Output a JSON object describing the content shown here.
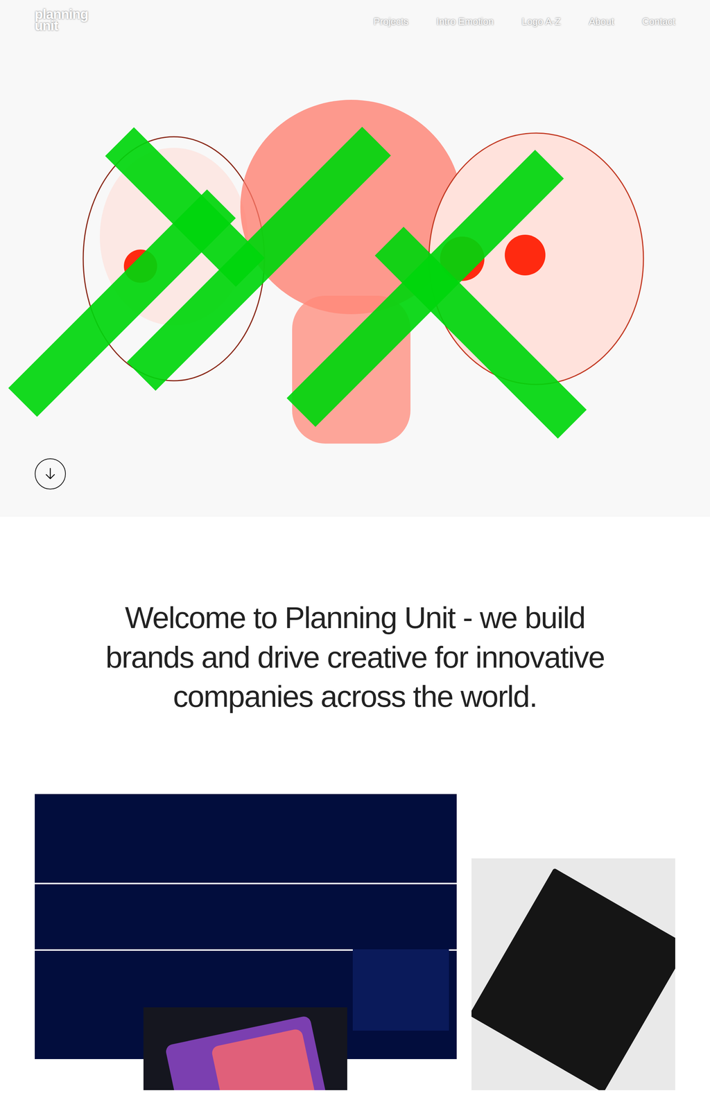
{
  "header": {
    "logo": [
      "planning",
      "unit"
    ],
    "nav": [
      {
        "label": "Projects",
        "selected": false
      },
      {
        "label": "Intro Emotion",
        "selected": false
      },
      {
        "label": "Logo A-Z",
        "selected": false
      },
      {
        "label": "About",
        "selected": false
      },
      {
        "label": "Contact",
        "selected": false
      }
    ]
  },
  "intro": {
    "text": "Welcome to Planning Unit - we build brands and drive creative for innovative companies across the world."
  }
}
